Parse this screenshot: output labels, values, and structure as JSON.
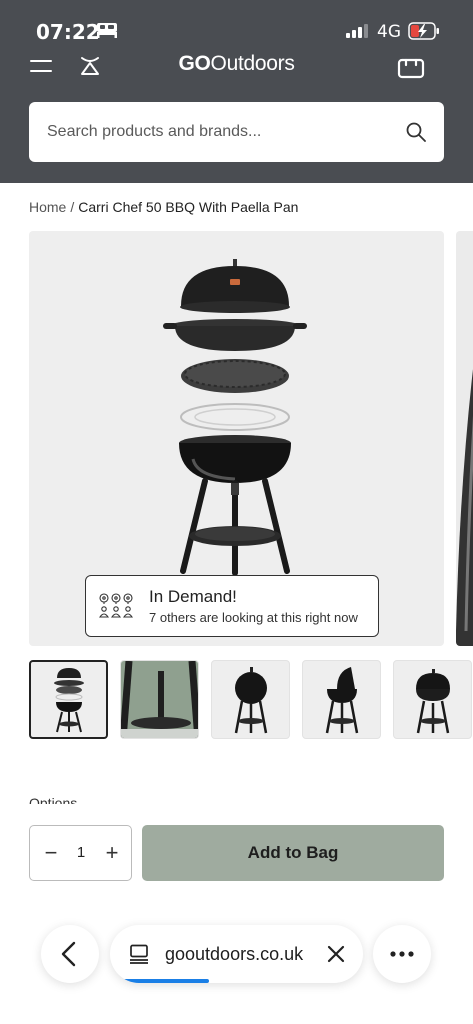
{
  "status_bar": {
    "time": "07:22",
    "network": "4G",
    "icons": [
      "bed-icon",
      "signal-icon",
      "battery-charging-icon"
    ]
  },
  "header": {
    "logo_bold": "GO",
    "logo_rest": "Outdoors",
    "icons": [
      "menu-icon",
      "camp-icon",
      "bag-icon"
    ],
    "background": "#4a4d52"
  },
  "search": {
    "placeholder": "Search products and brands..."
  },
  "breadcrumb": {
    "home": "Home",
    "separator": "/",
    "current": "Carri Chef 50 BBQ With Paella Pan"
  },
  "in_demand": {
    "title": "In Demand!",
    "subtitle": "7 others are looking at this right now"
  },
  "thumbnails": {
    "count": 5,
    "selected_index": 0
  },
  "options_label": "Options",
  "quantity": {
    "value": "1",
    "minus": "−",
    "plus": "+"
  },
  "add_to_bag": {
    "label": "Add to Bag",
    "color": "#9fab9f"
  },
  "browser": {
    "url": "gooutdoors.co.uk",
    "load_progress": 0.38,
    "progress_color": "#1a7fe6"
  }
}
